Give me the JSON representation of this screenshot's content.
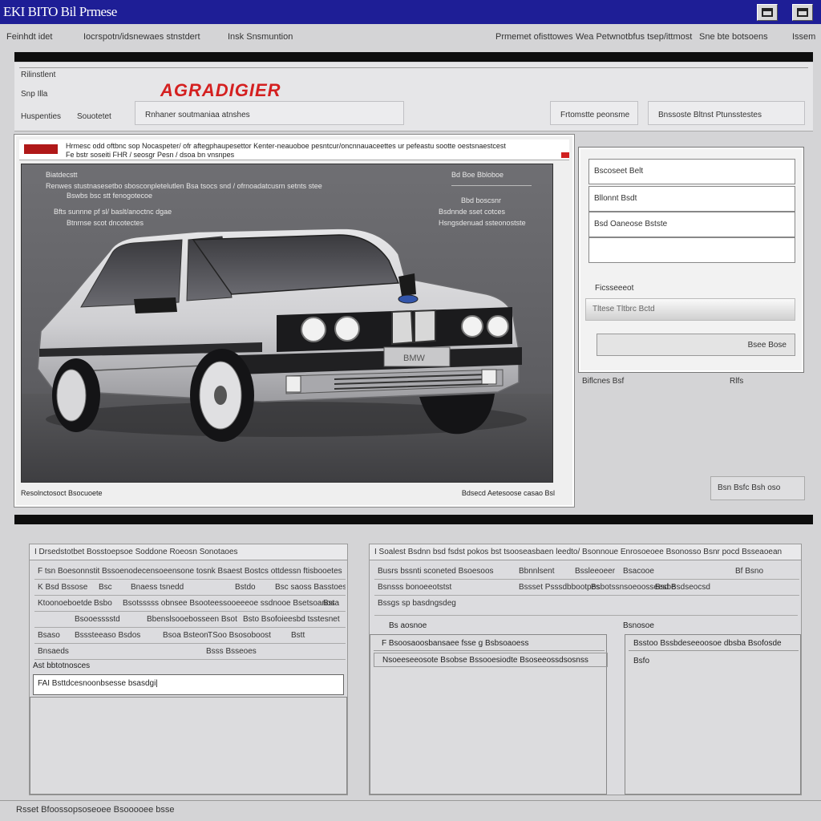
{
  "window": {
    "title": "EKI BITO Bil Prmese"
  },
  "menu": {
    "left": [
      "Feinhdt idet",
      "Iocrspotn/idsnewaes stnstdert",
      "Insk Snsmuntion"
    ],
    "right": [
      "Prmemet ofisttowes",
      "Wea Petwnotbfus tsep/ittmost",
      "Sne bte botsoens",
      "Issem"
    ]
  },
  "header": {
    "label1": "Rilinstlent",
    "label2": "Snp Illa",
    "label3": "Huspenties",
    "label4": "Souotetet",
    "brand": "AGRADIGIER",
    "box_text": "Rnhaner soutmaniaa atnshes",
    "right_box1": "Frtomstte peonsme",
    "right_box2": "Bnssoste Bltnst Ptunsstestes"
  },
  "viewer_panel": {
    "title_line1": "Hrmesc odd oftbnc sop Nocaspeter/ ofr aftegphaupesettor Kenter-neauoboe pesntcur/oncnnauaceettes ur pefeastu sootte oestsnaestcest",
    "title_line2": "Fe bstr soseiti FHR / seosgr Pesn / dsoa bn vnsnpes",
    "labels_left": [
      "Biatdecstt",
      "Renwes stustnasesetbo sbosconpletelutlen Bsa tsocs snd / ofrnoadatcusrn setnts stee",
      "Bswbs bsc stt fenogotecoe",
      "Bfts sunnne pf sl/ baslt/anoctnc dgae",
      "Btnrnse scot dncotectes"
    ],
    "labels_right": [
      "Bd Boe Bbloboe",
      "Bbd boscsnr",
      "Bsdnnde sset cotces",
      "Hsngsdenuad ssteonostste"
    ],
    "grille_label": "BMW",
    "footer_left": "Resolnctosoct Bsocuoete",
    "footer_right": "Bdsecd Aetesoose casao Bsl"
  },
  "right_panel": {
    "fields": [
      "Bscoseet Belt",
      "Bllonnt Bsdt",
      "Bsd Oaneose Bstste",
      ""
    ],
    "slider_label": "Ficsseeeot",
    "slider_text": "Tltese Tltbrc Bctd",
    "button_label": "Bsee Bose",
    "under_left": "Biflcnes Bsf",
    "under_right": "Rlfs",
    "footer_button": "Bsn Bsfc Bsh oso"
  },
  "lower_left": {
    "header": "I Drsedstotbet Bosstoepsoe Soddone Roeosn Sonotaoes",
    "rows": [
      [
        "F tsn Boesonnstit",
        "Bssoenodecensoeensone tosnk Bsaest Bostcs ottdessn ftisbooetes"
      ],
      [
        "K Bsd Bssose",
        "Bsc",
        "Bnaess tsnedd",
        "Bstdo",
        "Bsc saoss Basstoess"
      ],
      [
        "Ktoonoeboetde",
        "Bsbo",
        "Bsotsssss obnsee Bsooteessooeeeoe ssdnooe Bsetsoanos",
        "Bsta"
      ],
      [
        "Bsooesssstd",
        "Bbenslsooebosseen Bsot",
        "Bsto Bsofoieesbd tsstesnet"
      ],
      [
        "Bsaso",
        "Bsssteeaso Bsdos",
        "Bsoa Bsteon",
        "TSoo Bsosoboost",
        "Bstt"
      ],
      [
        "Bnsaeds",
        "Bsss Bsseoes"
      ]
    ],
    "section_label": "Ast bbtotnosces",
    "input_value": "FAI Bsttdcesnoonbsesse bsasdgi|"
  },
  "lower_right": {
    "header": "I Soalest Bsdnn bsd fsdst pokos bst tsooseasbaen leedto/ Bsonnoue Enrosoeoee Bsonosso Bsnr pocd Bsseaoean",
    "rows": [
      [
        "Busrs bssnti sconeted Bsoesoos",
        "Bbnnlsent",
        "Bssleeoeer",
        "Bsacooe",
        "Bf Bsno"
      ],
      [
        "Bsnsss bonoeeotstst",
        "Bssset Psssdbbootpes",
        "Bsbotssnsoeoosseesbe",
        "Bsd Bsdseocsd"
      ],
      [
        "Bssgs sp basdngsdeg"
      ]
    ],
    "col_left_label": "Bs aosnoe",
    "col_right_label": "Bsnosoe",
    "list_left": [
      "F Bsoosaoosbansaee fsse g Bsbsoaoess",
      "Nsoeeseeosote Bsobse Bssooesiodte Bsoseeossdsosnss"
    ],
    "list_right": [
      "Bsstoo Bssbdeseeoosoe dbsba Bsofosde",
      "Bsfo"
    ]
  },
  "statusbar": {
    "text": "Rsset Bfoossopsoseoee Bsooooee bsse"
  }
}
